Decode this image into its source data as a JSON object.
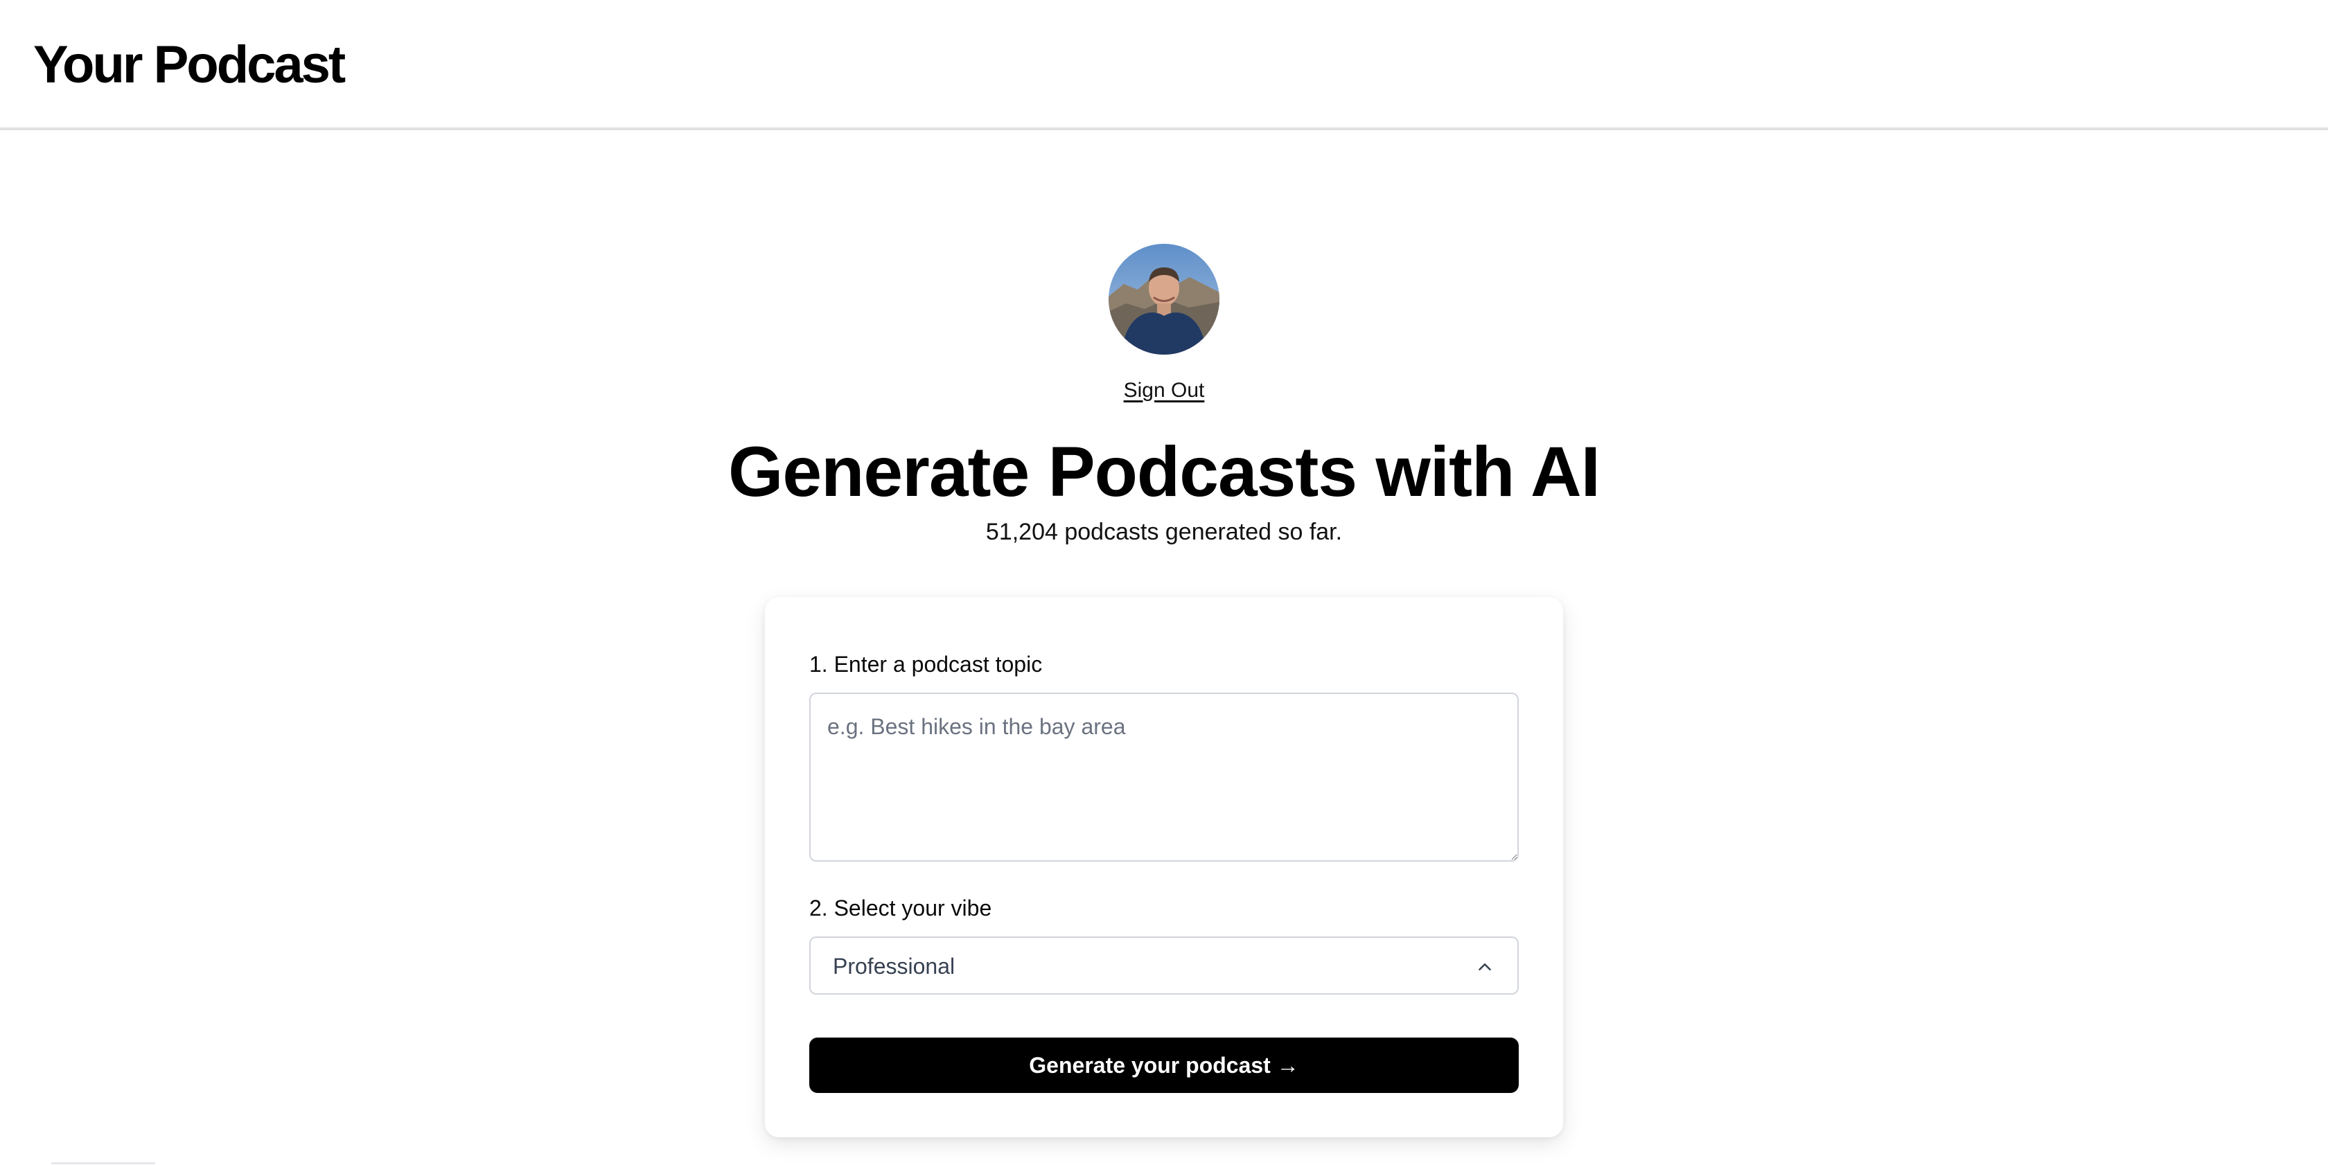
{
  "header": {
    "brand": "Your Podcast"
  },
  "user": {
    "avatar_alt": "User avatar",
    "sign_out_label": "Sign Out"
  },
  "hero": {
    "title": "Generate Podcasts with AI",
    "subtitle": "51,204 podcasts generated so far."
  },
  "form": {
    "topic_label": "1. Enter a podcast topic",
    "topic_value": "",
    "topic_placeholder": "e.g. Best hikes in the bay area",
    "vibe_label": "2. Select your vibe",
    "vibe_selected": "Professional",
    "vibe_icon": "chevron-up-icon",
    "submit_label": "Generate your podcast →"
  },
  "colors": {
    "primary_button": "#000000",
    "border": "#d1d5db",
    "placeholder": "#6b7280"
  }
}
